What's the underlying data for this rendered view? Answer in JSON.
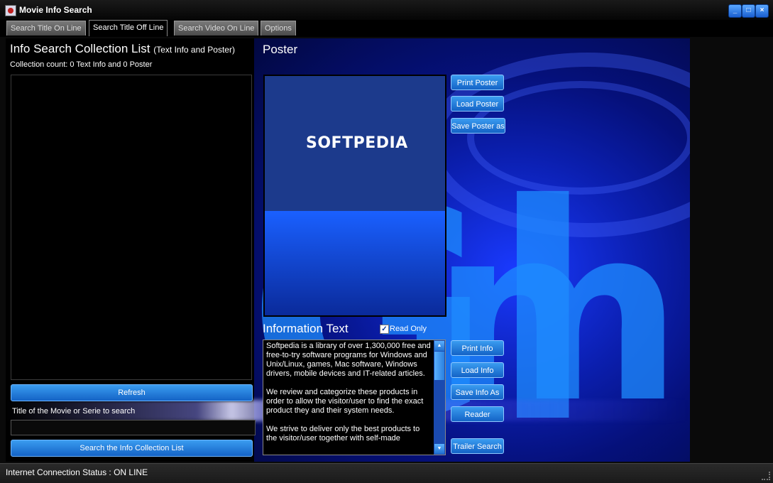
{
  "window": {
    "title": "Movie Info Search",
    "minimize": "_",
    "maximize": "□",
    "close": "×"
  },
  "tabs": [
    {
      "label": "Search Title On Line"
    },
    {
      "label": "Search Title Off Line"
    },
    {
      "label": "Search Video On Line"
    },
    {
      "label": "Options"
    }
  ],
  "collection": {
    "heading": "Info Search Collection List",
    "heading_note": "(Text Info and Poster)",
    "count": "Collection count: 0 Text Info and 0 Poster",
    "refresh_label": "Refresh",
    "search_label": "Title of the Movie or Serie to search",
    "search_value": "",
    "search_button": "Search the Info Collection List"
  },
  "poster": {
    "heading": "Poster",
    "logo_text": "SOFTPEDIA",
    "print_label": "Print Poster",
    "load_label": "Load Poster",
    "save_label": "Save Poster as"
  },
  "info": {
    "heading": "Information Text",
    "readonly_label": "Read Only",
    "readonly_checked": true,
    "text": "Softpedia is a library of over 1,300,000 free and free-to-try software programs for Windows and Unix/Linux, games, Mac software, Windows drivers, mobile devices and IT-related articles.\n\nWe review and categorize these products in order to allow the visitor/user to find the exact product they and their system needs.\n\nWe strive to deliver only the best products to the visitor/user together with self-made",
    "print_label": "Print Info",
    "load_label": "Load Info",
    "save_label": "Save Info As",
    "reader_label": "Reader",
    "trailer_label": "Trailer Search"
  },
  "status": {
    "text": "Internet Connection Status : ON LINE"
  },
  "colors": {
    "accent": "#1463c6",
    "background_art": "#0b1fb0"
  }
}
